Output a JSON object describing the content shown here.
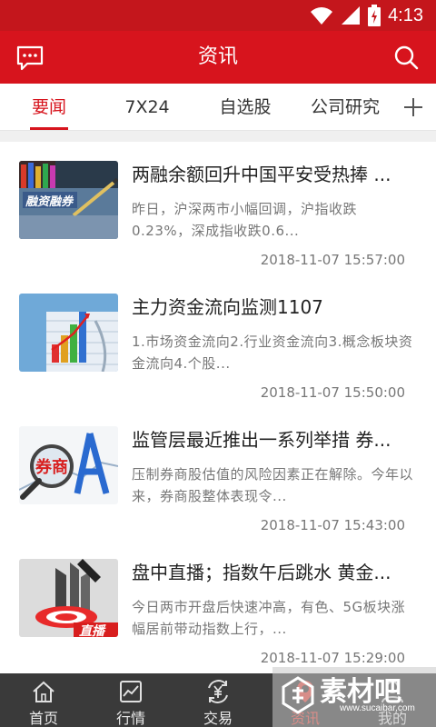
{
  "status_bar": {
    "time": "4:13"
  },
  "header": {
    "title": "资讯"
  },
  "tabs": [
    {
      "label": "要闻",
      "active": true
    },
    {
      "label": "7X24",
      "active": false
    },
    {
      "label": "自选股",
      "active": false
    },
    {
      "label": "公司研究",
      "active": false
    }
  ],
  "news": [
    {
      "title": "两融余额回升中国平安受热捧 ...",
      "summary": "昨日，沪深两市小幅回调，沪指收跌0.23%，深成指收跌0.6...",
      "time": "2018-11-07 15:57:00",
      "thumb_text": "融资融券"
    },
    {
      "title": "主力资金流向监测1107",
      "summary": "1.市场资金流向2.行业资金流向3.概念板块资金流向4.个股...",
      "time": "2018-11-07 15:50:00",
      "thumb_text": ""
    },
    {
      "title": "监管层最近推出一系列举措 券...",
      "summary": "压制券商股估值的风险因素正在解除。今年以来，券商股整体表现令...",
      "time": "2018-11-07 15:43:00",
      "thumb_text": "券商"
    },
    {
      "title": "盘中直播；指数午后跳水 黄金...",
      "summary": "今日两市开盘后快速冲高，有色、5G板块涨幅居前带动指数上行，...",
      "time": "2018-11-07 15:29:00",
      "thumb_text": "直播"
    }
  ],
  "bottom_nav": [
    {
      "label": "首页",
      "icon": "home-icon",
      "active": false
    },
    {
      "label": "行情",
      "icon": "chart-icon",
      "active": false
    },
    {
      "label": "交易",
      "icon": "yen-icon",
      "active": false
    },
    {
      "label": "资讯",
      "icon": "news-icon",
      "active": true
    },
    {
      "label": "我的",
      "icon": "user-icon",
      "active": false
    }
  ],
  "watermark": {
    "text": "素材吧",
    "url": "www.sucaibar.com"
  },
  "colors": {
    "brand_red": "#d7141d",
    "nav_bg": "#3a3a3a",
    "active_nav": "#e8453c"
  }
}
